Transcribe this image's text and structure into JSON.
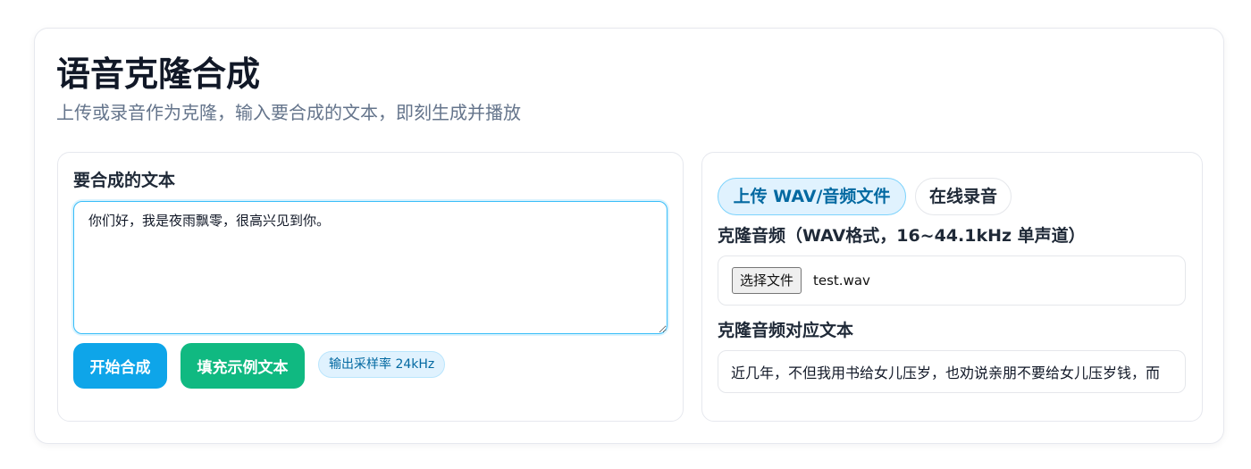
{
  "header": {
    "title": "语音克隆合成",
    "subtitle": "上传或录音作为克隆，输入要合成的文本，即刻生成并播放"
  },
  "synthesis": {
    "label": "要合成的文本",
    "text_value": "你们好，我是夜雨飘零，很高兴见到你。",
    "start_button": "开始合成",
    "fill_button": "填充示例文本",
    "sample_rate_badge": "输出采样率 24kHz"
  },
  "clone": {
    "tabs": [
      {
        "label": "上传 WAV/音频文件",
        "active": true
      },
      {
        "label": "在线录音",
        "active": false
      }
    ],
    "audio_label": "克隆音频（WAV格式，16~44.1kHz 单声道）",
    "file_button": "选择文件",
    "file_name": "test.wav",
    "ref_text_label": "克隆音频对应文本",
    "ref_text_value": "近几年，不但我用书给女儿压岁，也劝说亲朋不要给女儿压岁钱，而"
  },
  "colors": {
    "primary": "#0ea5e9",
    "success": "#10b981",
    "badge_bg": "#e0f2fe",
    "badge_text": "#0369a1"
  }
}
